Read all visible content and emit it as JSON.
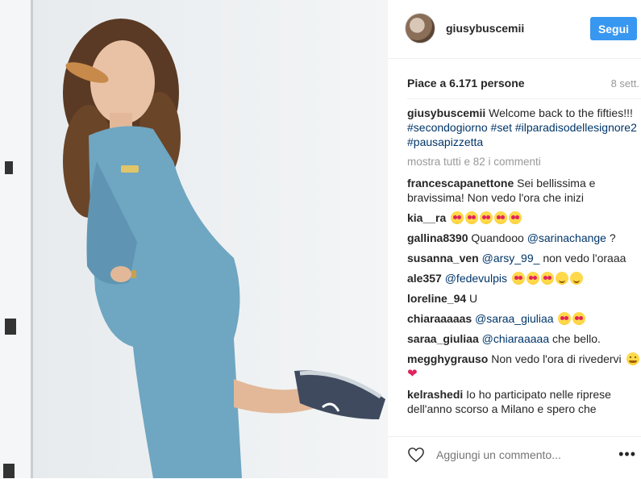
{
  "post": {
    "image": {
      "description_icon": "photo-icon"
    },
    "header": {
      "username": "giusybuscemii",
      "follow_label": "Segui"
    },
    "likes_text": "Piace a 6.171 persone",
    "date_text": "8 sett.",
    "caption": {
      "username": "giusybuscemii",
      "text": "Welcome back to the fifties!!!",
      "tags": [
        "#secondogiorno",
        "#set",
        "#ilparadisodellesignore2",
        "#pausapizzetta"
      ]
    },
    "more_comments": "mostra tutti e 82 i commenti",
    "comments": [
      {
        "user": "francescapanettone",
        "text": "Sei bellissima e bravissima! Non vedo l'ora che inizi"
      },
      {
        "user": "kia__ra",
        "text": ""
      },
      {
        "user": "gallina8390",
        "text": "Quandooo",
        "mention": "@sarinachange",
        "after": " ?"
      },
      {
        "user": "susanna_ven",
        "mention": "@arsy_99_",
        "text": "non vedo l'oraaa"
      },
      {
        "user": "ale357",
        "mention": "@fedevulpis"
      },
      {
        "user": "loreline_94",
        "text": "U"
      },
      {
        "user": "chiaraaaaas",
        "mention": "@saraa_giuliaa"
      },
      {
        "user": "saraa_giuliaa",
        "mention": "@chiaraaaaa",
        "text": "che bello."
      },
      {
        "user": "megghygrauso",
        "text": "Non vedo l'ora di rivedervi"
      },
      {
        "user": "kelrashedi",
        "text": "Io ho participato nelle riprese dell'anno scorso a Milano e spero che"
      }
    ],
    "footer": {
      "comment_placeholder": "Aggiungi un commento...",
      "more_label": "•••"
    }
  },
  "colors": {
    "follow_bg": "#3897f0",
    "tag": "#003569",
    "muted": "#999999"
  }
}
